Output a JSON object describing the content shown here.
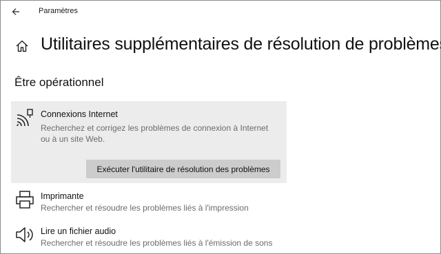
{
  "window": {
    "app_title": "Paramètres"
  },
  "page": {
    "title": "Utilitaires supplémentaires de résolution de problèmes"
  },
  "section": {
    "heading": "Être opérationnel"
  },
  "troubleshooters": [
    {
      "name": "Connexions Internet",
      "description": "Recherchez et corrigez les problèmes de connexion à Internet ou à un site Web.",
      "icon": "wifi-icon",
      "expanded": true,
      "run_button_label": "Exécuter l'utilitaire de résolution des problèmes"
    },
    {
      "name": "Imprimante",
      "description": "Rechercher et résoudre les problèmes liés à l'impression",
      "icon": "printer-icon"
    },
    {
      "name": "Lire un fichier audio",
      "description": "Rechercher et résoudre les problèmes liés à l'émission de sons",
      "icon": "speaker-icon"
    }
  ],
  "colors": {
    "card_background": "#ececec",
    "button_background": "#cccccc",
    "description_text": "#6b6b6b"
  }
}
